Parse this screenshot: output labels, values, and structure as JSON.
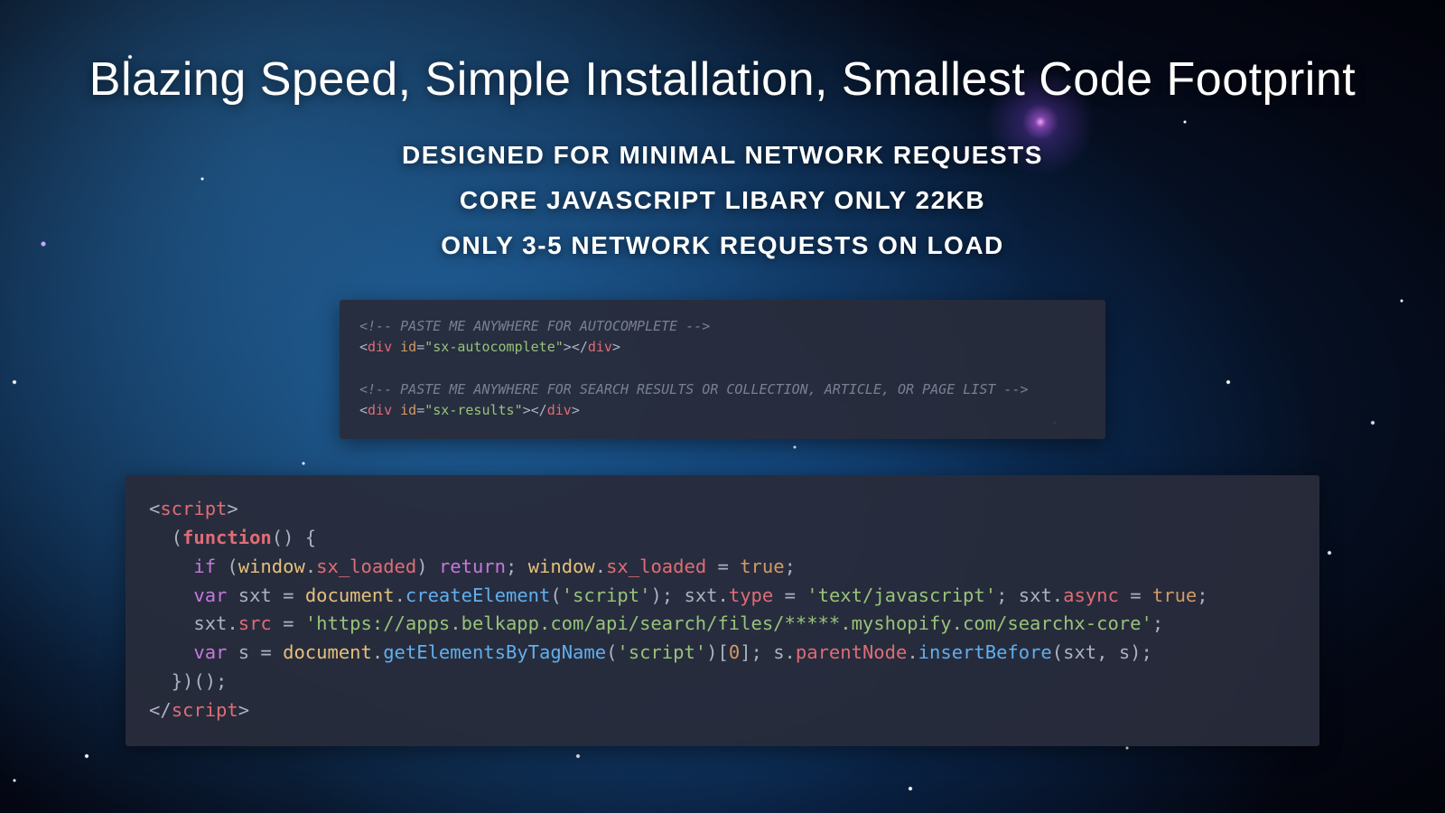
{
  "title": "Blazing Speed, Simple Installation, Smallest Code Footprint",
  "sublines": [
    "DESIGNED FOR MINIMAL NETWORK REQUESTS",
    "CORE JAVASCRIPT LIBARY ONLY 22KB",
    "ONLY 3-5 NETWORK REQUESTS ON LOAD"
  ],
  "snippet1": {
    "comment1": "<!-- PASTE ME ANYWHERE FOR AUTOCOMPLETE -->",
    "line2_open_lt": "<",
    "line2_tag": "div",
    "line2_attr": "id",
    "line2_eq": "=",
    "line2_val": "\"sx-autocomplete\"",
    "line2_close1": ">",
    "line2_close2": "</",
    "line2_close3": ">",
    "comment2": "<!-- PASTE ME ANYWHERE FOR SEARCH RESULTS OR COLLECTION, ARTICLE, OR PAGE LIST -->",
    "line4_val": "\"sx-results\""
  },
  "snippet2": {
    "l1_lt": "<",
    "l1_tag": "script",
    "l1_gt": ">",
    "l2_p1": "  (",
    "l2_fn": "function",
    "l2_p2": "() {",
    "l3_indent": "    ",
    "l3_if": "if",
    "l3_p1": " (",
    "l3_w1": "window",
    "l3_d1": ".",
    "l3_sx": "sx_loaded",
    "l3_p2": ") ",
    "l3_ret": "return",
    "l3_p3": "; ",
    "l3_w2": "window",
    "l3_d2": ".",
    "l3_sx2": "sx_loaded",
    "l3_p4": " = ",
    "l3_true": "true",
    "l3_p5": ";",
    "l4_indent": "    ",
    "l4_var": "var",
    "l4_p1": " sxt = ",
    "l4_doc": "document",
    "l4_d1": ".",
    "l4_ce": "createElement",
    "l4_p2": "(",
    "l4_str1": "'script'",
    "l4_p3": "); sxt.",
    "l4_type": "type",
    "l4_p4": " = ",
    "l4_str2": "'text/javascript'",
    "l4_p5": "; sxt.",
    "l4_async": "async",
    "l4_p6": " = ",
    "l4_true": "true",
    "l4_p7": ";",
    "l5_indent": "    sxt.",
    "l5_src": "src",
    "l5_p1": " = ",
    "l5_str": "'https://apps.belkapp.com/api/search/files/*****.myshopify.com/searchx-core'",
    "l5_p2": ";",
    "l6_indent": "    ",
    "l6_var": "var",
    "l6_p1": " s = ",
    "l6_doc": "document",
    "l6_d1": ".",
    "l6_get": "getElementsByTagName",
    "l6_p2": "(",
    "l6_str": "'script'",
    "l6_p3": ")[",
    "l6_zero": "0",
    "l6_p4": "]; s.",
    "l6_pn": "parentNode",
    "l6_d2": ".",
    "l6_ib": "insertBefore",
    "l6_p5": "(sxt, s);",
    "l7": "  })();",
    "l8_lt": "</",
    "l8_tag": "script",
    "l8_gt": ">"
  }
}
